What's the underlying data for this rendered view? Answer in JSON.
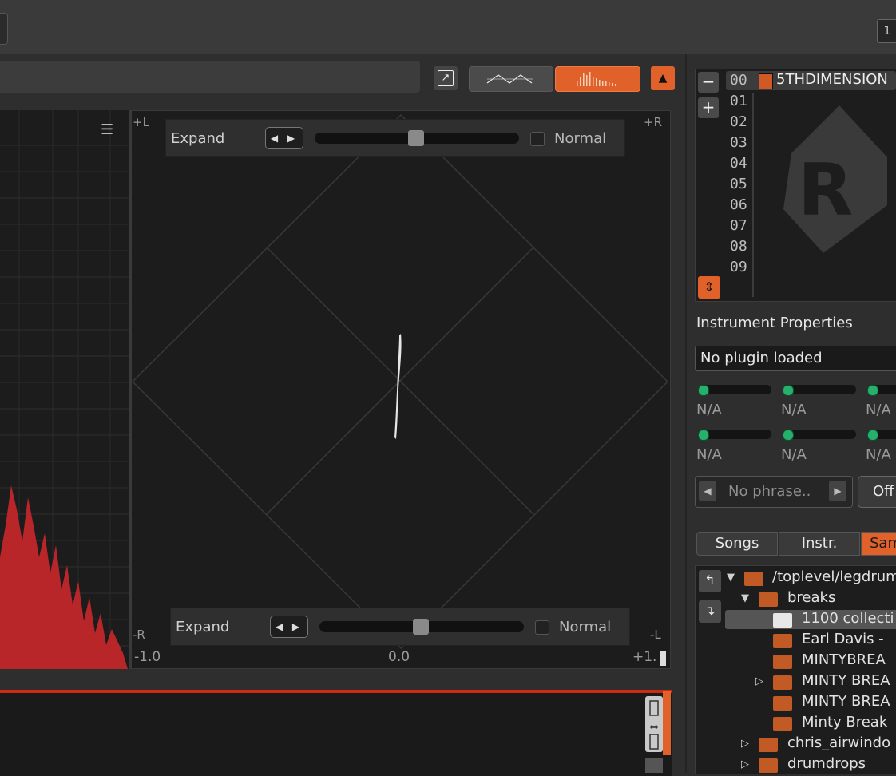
{
  "topbar": {
    "right_button_label": "1"
  },
  "scope_header": {
    "detach_icon": "detach-icon",
    "modes": [
      {
        "name": "scope",
        "icon": "waveform-wave-icon",
        "active": false
      },
      {
        "name": "spectrum",
        "icon": "spectrum-bars-icon",
        "active": true
      }
    ],
    "collapse_icon": "triangle-up-icon"
  },
  "scope": {
    "corner_top_left": "+L",
    "corner_top_right": "+R",
    "corner_bottom_left": "-R",
    "corner_bottom_right": "-L",
    "top_expander": {
      "label": "Expand",
      "slider_value": 0.5,
      "normal_label": "Normal"
    },
    "bottom_expander": {
      "label": "Expand",
      "slider_value": 0.5,
      "normal_label": "Normal"
    },
    "x_axis": {
      "min_label": "-1.0",
      "mid_label": "0.0",
      "max_label": "+1."
    }
  },
  "instruments": {
    "remove_label": "−",
    "add_label": "+",
    "numbers": [
      "00",
      "01",
      "02",
      "03",
      "04",
      "05",
      "06",
      "07",
      "08",
      "09"
    ],
    "selected_name": "5THDIMENSION"
  },
  "instrument_properties": {
    "title": "Instrument Properties",
    "plugin": "No plugin loaded",
    "macros": [
      "N/A",
      "N/A",
      "N/A",
      "N/A",
      "N/A",
      "N/A"
    ],
    "phrase": "No phrase..",
    "off_label": "Off"
  },
  "browser": {
    "tabs": [
      "Songs",
      "Instr.",
      "Sam"
    ],
    "active_tab": "Sam",
    "tree": [
      {
        "label": "/toplevel/legdrum",
        "level": 0,
        "expanded": true,
        "selected": false
      },
      {
        "label": "breaks",
        "level": 1,
        "expanded": true,
        "selected": false
      },
      {
        "label": "1100 collecti",
        "level": 2,
        "expanded": false,
        "selected": true
      },
      {
        "label": "Earl Davis -",
        "level": 2,
        "expanded": false,
        "selected": false
      },
      {
        "label": "MINTYBREA",
        "level": 2,
        "expanded": false,
        "selected": false
      },
      {
        "label": "MINTY BREA",
        "level": 2,
        "expanded": false,
        "selected": false,
        "has_children": true
      },
      {
        "label": "MINTY BREA",
        "level": 2,
        "expanded": false,
        "selected": false
      },
      {
        "label": "Minty Break",
        "level": 2,
        "expanded": false,
        "selected": false
      },
      {
        "label": "chris_airwindo",
        "level": 1,
        "expanded": false,
        "selected": false,
        "has_children": true
      },
      {
        "label": "drumdrops",
        "level": 1,
        "expanded": false,
        "selected": false,
        "has_children": true
      }
    ]
  },
  "colors": {
    "accent": "#e0622a",
    "spectrum": "#b8262a",
    "meter": "#27b06b"
  }
}
